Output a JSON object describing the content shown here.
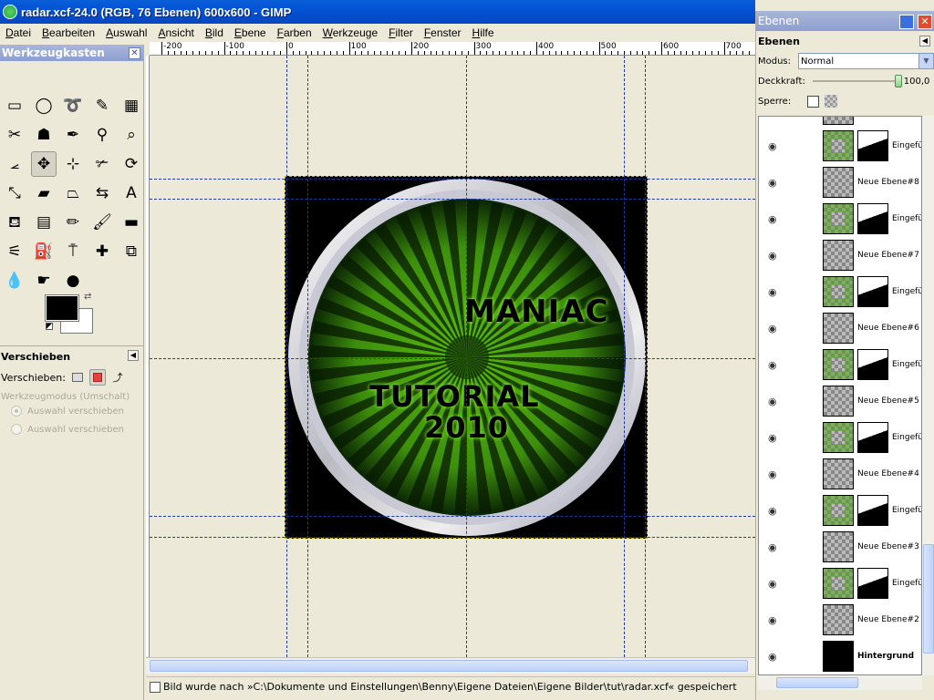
{
  "window": {
    "title": "radar.xcf-24.0 (RGB, 76 Ebenen) 600x600 - GIMP"
  },
  "menu": [
    "Datei",
    "Bearbeiten",
    "Auswahl",
    "Ansicht",
    "Bild",
    "Ebene",
    "Farben",
    "Werkzeuge",
    "Filter",
    "Fenster",
    "Hilfe"
  ],
  "toolbox": {
    "title": "Werkzeugkasten",
    "tools": [
      {
        "name": "rect-select-icon",
        "glyph": "▭"
      },
      {
        "name": "ellipse-select-icon",
        "glyph": "◯"
      },
      {
        "name": "free-select-icon",
        "glyph": "➰"
      },
      {
        "name": "fuzzy-select-icon",
        "glyph": "✎"
      },
      {
        "name": "color-select-icon",
        "glyph": "▦"
      },
      {
        "name": "scissors-icon",
        "glyph": "✂"
      },
      {
        "name": "foreground-select-icon",
        "glyph": "☗"
      },
      {
        "name": "paths-icon",
        "glyph": "✒"
      },
      {
        "name": "color-picker-icon",
        "glyph": "⚲"
      },
      {
        "name": "zoom-icon",
        "glyph": "⌕"
      },
      {
        "name": "measure-icon",
        "glyph": "⦟"
      },
      {
        "name": "move-icon",
        "glyph": "✥"
      },
      {
        "name": "align-icon",
        "glyph": "⊹"
      },
      {
        "name": "crop-icon",
        "glyph": "✃"
      },
      {
        "name": "rotate-icon",
        "glyph": "⟳"
      },
      {
        "name": "scale-icon",
        "glyph": "⤡"
      },
      {
        "name": "shear-icon",
        "glyph": "▰"
      },
      {
        "name": "perspective-icon",
        "glyph": "⏢"
      },
      {
        "name": "flip-icon",
        "glyph": "⇆"
      },
      {
        "name": "text-icon",
        "glyph": "A"
      },
      {
        "name": "bucket-fill-icon",
        "glyph": "⛾"
      },
      {
        "name": "blend-icon",
        "glyph": "▤"
      },
      {
        "name": "pencil-icon",
        "glyph": "✏"
      },
      {
        "name": "paintbrush-icon",
        "glyph": "🖌"
      },
      {
        "name": "eraser-icon",
        "glyph": "▬"
      },
      {
        "name": "airbrush-icon",
        "glyph": "⚟"
      },
      {
        "name": "ink-icon",
        "glyph": "⛽"
      },
      {
        "name": "clone-icon",
        "glyph": "⍑"
      },
      {
        "name": "heal-icon",
        "glyph": "✚"
      },
      {
        "name": "perspective-clone-icon",
        "glyph": "⧉"
      },
      {
        "name": "blur-icon",
        "glyph": "💧"
      },
      {
        "name": "smudge-icon",
        "glyph": "☛"
      },
      {
        "name": "dodge-burn-icon",
        "glyph": "●"
      }
    ],
    "colors": {
      "foreground": "#000000",
      "background": "#ffffff"
    }
  },
  "tool_options": {
    "title": "Verschieben",
    "move_label": "Verschieben:",
    "mode_label": "Werkzeugmodus (Umschalt)",
    "options": [
      "Auswahl verschieben",
      "Auswahl verschieben"
    ]
  },
  "ruler": {
    "labels": [
      "-200",
      "-100",
      "0",
      "100",
      "200",
      "300",
      "400",
      "500",
      "600",
      "700"
    ]
  },
  "image": {
    "text_line1": "MANIAC",
    "text_line2": "TUTORIAL",
    "text_line3": "2010"
  },
  "status": {
    "message": "Bild wurde nach »C:\\Dokumente und Einstellungen\\Benny\\Eigene Dateien\\Eigene Bilder\\tut\\radar.xcf« gespeichert"
  },
  "layers": {
    "dock_title": "Ebenen",
    "panel_title": "Ebenen",
    "mode_label": "Modus:",
    "mode_value": "Normal",
    "opacity_label": "Deckkraft:",
    "opacity_value": "100,0",
    "opacity_fraction": 1.0,
    "lock_label": "Sperre:",
    "rows": [
      {
        "name": "Eingefü",
        "type": "masked"
      },
      {
        "name": "Neue Ebene#8",
        "type": "plain"
      },
      {
        "name": "Eingefü",
        "type": "masked"
      },
      {
        "name": "Neue Ebene#7",
        "type": "plain"
      },
      {
        "name": "Eingefü",
        "type": "masked"
      },
      {
        "name": "Neue Ebene#6",
        "type": "plain"
      },
      {
        "name": "Eingefü",
        "type": "masked"
      },
      {
        "name": "Neue Ebene#5",
        "type": "plain"
      },
      {
        "name": "Eingefü",
        "type": "masked"
      },
      {
        "name": "Neue Ebene#4",
        "type": "plain"
      },
      {
        "name": "Eingefü",
        "type": "masked"
      },
      {
        "name": "Neue Ebene#3",
        "type": "plain"
      },
      {
        "name": "Eingefü",
        "type": "masked"
      },
      {
        "name": "Neue Ebene#2",
        "type": "plain"
      },
      {
        "name": "Hintergrund",
        "type": "background"
      }
    ]
  }
}
